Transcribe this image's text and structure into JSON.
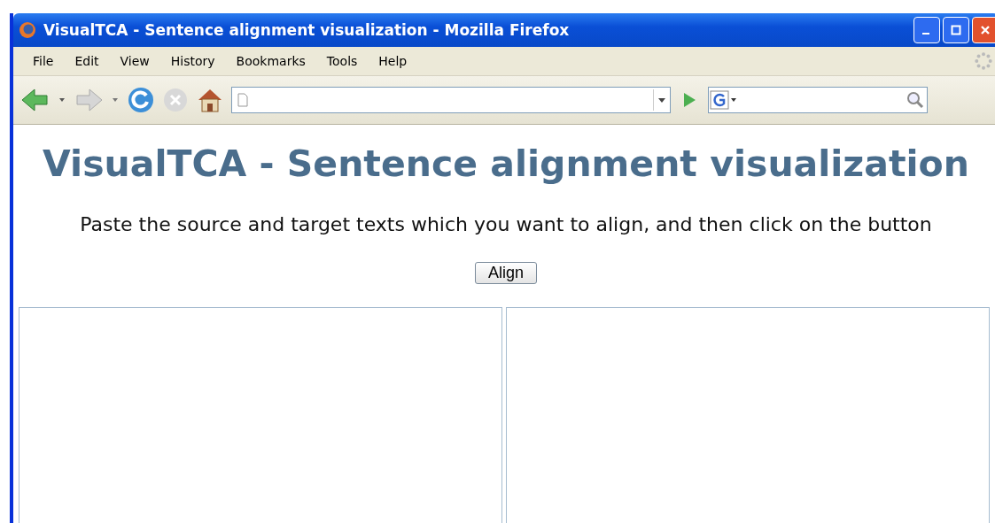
{
  "window": {
    "title": "VisualTCA - Sentence alignment visualization - Mozilla Firefox"
  },
  "menu": [
    "File",
    "Edit",
    "View",
    "History",
    "Bookmarks",
    "Tools",
    "Help"
  ],
  "page": {
    "heading": "VisualTCA - Sentence alignment visualization",
    "instruction": "Paste the source and target texts which you want to align, and then click on the button",
    "button": "Align"
  }
}
